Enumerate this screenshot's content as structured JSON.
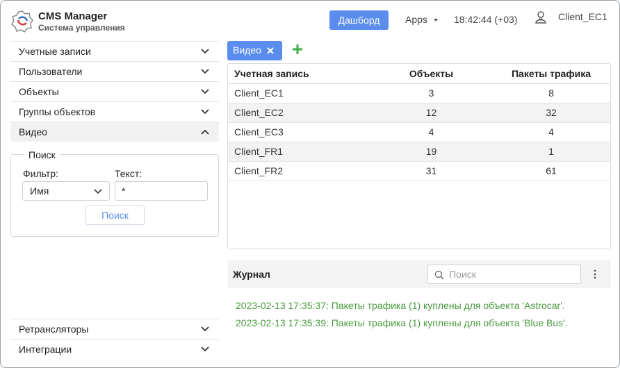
{
  "header": {
    "app_title": "CMS Manager",
    "app_subtitle": "Система управления",
    "dashboard_button": "Дашборд",
    "apps_menu": "Apps",
    "clock": "18:42:44 (+03)",
    "user": "Client_EC1"
  },
  "sidebar": {
    "items": [
      {
        "label": "Учетные записи"
      },
      {
        "label": "Пользователи"
      },
      {
        "label": "Объекты"
      },
      {
        "label": "Группы объектов"
      },
      {
        "label": "Видео"
      }
    ],
    "bottom_items": [
      {
        "label": "Ретрансляторы"
      },
      {
        "label": "Интеграции"
      }
    ],
    "search": {
      "legend": "Поиск",
      "filter_label": "Фильтр:",
      "filter_value": "Имя",
      "text_label": "Текст:",
      "text_value": "*",
      "button": "Поиск"
    }
  },
  "tabs": [
    {
      "label": "Видео"
    }
  ],
  "table": {
    "columns": [
      "Учетная запись",
      "Объекты",
      "Пакеты трафика"
    ],
    "rows": [
      [
        "Client_EC1",
        "3",
        "8"
      ],
      [
        "Client_EC2",
        "12",
        "32"
      ],
      [
        "Client_EC3",
        "4",
        "4"
      ],
      [
        "Client_FR1",
        "19",
        "1"
      ],
      [
        "Client_FR2",
        "31",
        "61"
      ]
    ]
  },
  "journal": {
    "title": "Журнал",
    "search_placeholder": "Поиск",
    "entries": [
      "2023-02-13 17:35:37: Пакеты трафика (1) куплены для объекта 'Astrocar'.",
      "2023-02-13 17:35:39: Пакеты трафика (1) куплены для объекта 'Blue Bus'."
    ]
  },
  "colors": {
    "accent": "#5b8def",
    "add_icon": "#3fae49",
    "log_text": "#4a9a3f"
  }
}
